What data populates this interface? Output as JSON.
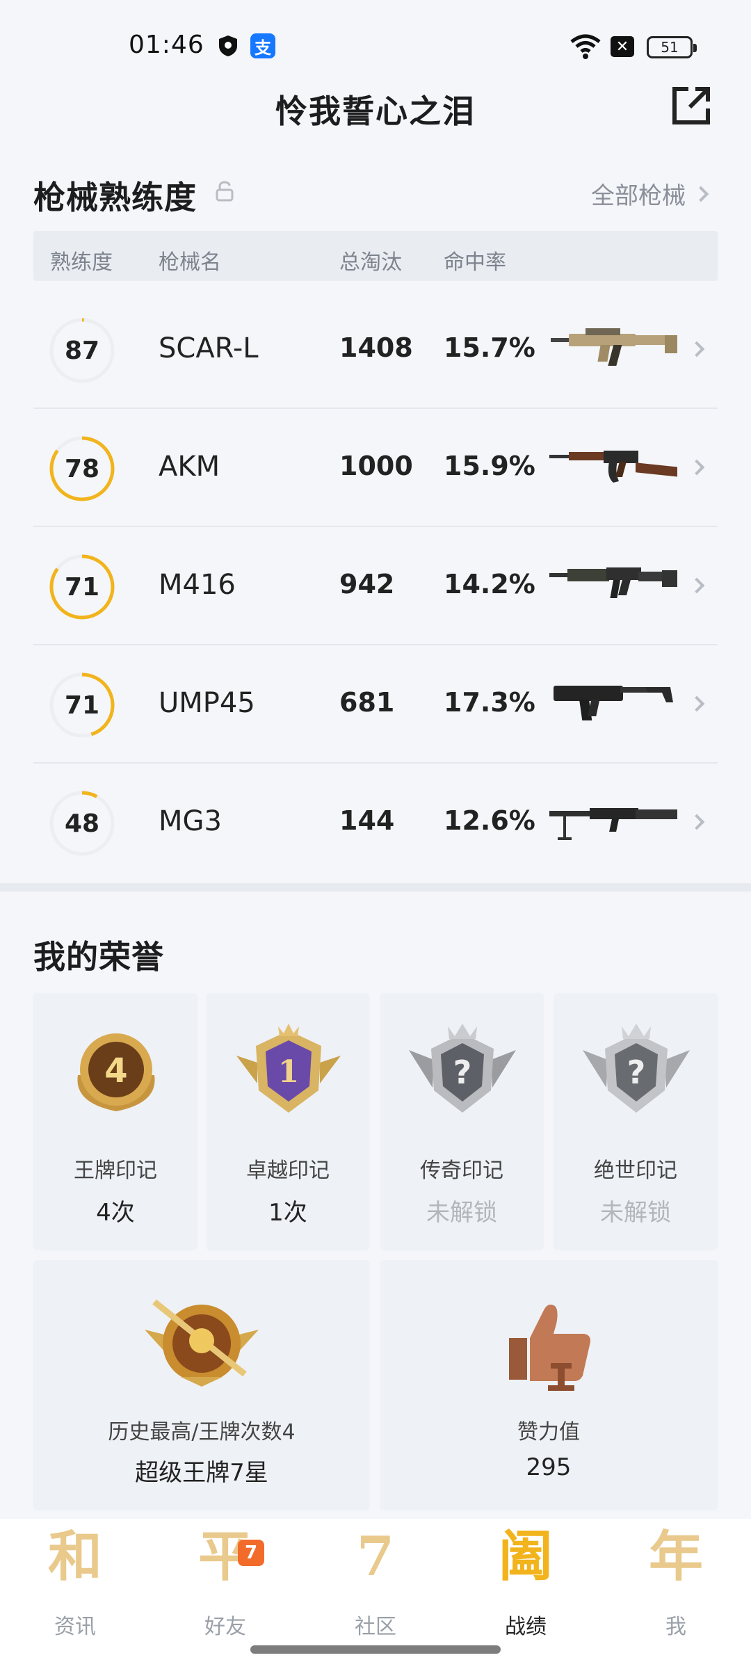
{
  "status_bar": {
    "time": "01:46",
    "alipay_glyph": "支",
    "battery": "51",
    "x_glyph": "✕"
  },
  "header": {
    "title": "怜我誓心之泪",
    "share_icon": "share-icon"
  },
  "weapons": {
    "title": "枪械熟练度",
    "all_link": "全部枪械",
    "columns": {
      "proficiency": "熟练度",
      "name": "枪械名",
      "kills": "总淘汰",
      "hit_rate": "命中率"
    },
    "rows": [
      {
        "level": "87",
        "name": "SCAR-L",
        "kills": "1408",
        "rate": "15.7%",
        "progress": 0.01
      },
      {
        "level": "78",
        "name": "AKM",
        "kills": "1000",
        "rate": "15.9%",
        "progress": 0.85
      },
      {
        "level": "71",
        "name": "M416",
        "kills": "942",
        "rate": "14.2%",
        "progress": 0.85
      },
      {
        "level": "71",
        "name": "UMP45",
        "kills": "681",
        "rate": "17.3%",
        "progress": 0.45
      },
      {
        "level": "48",
        "name": "MG3",
        "kills": "144",
        "rate": "12.6%",
        "progress": 0.08
      }
    ]
  },
  "honors": {
    "title": "我的荣誉",
    "marks": [
      {
        "label": "王牌印记",
        "value": "4次",
        "locked": false,
        "badge_num": "4"
      },
      {
        "label": "卓越印记",
        "value": "1次",
        "locked": false,
        "badge_num": "1"
      },
      {
        "label": "传奇印记",
        "value": "未解锁",
        "locked": true,
        "badge_num": "?"
      },
      {
        "label": "绝世印记",
        "value": "未解锁",
        "locked": true,
        "badge_num": "?"
      }
    ],
    "highest": {
      "label": "历史最高/王牌次数4",
      "value": "超级王牌7星"
    },
    "effort": {
      "label": "赞力值",
      "value": "295"
    }
  },
  "nav": {
    "items": [
      {
        "glyph": "和",
        "label": "资讯"
      },
      {
        "glyph": "平",
        "label": "好友",
        "badge": "7"
      },
      {
        "glyph": "7",
        "label": "社区"
      },
      {
        "glyph": "阖",
        "label": "战绩"
      },
      {
        "glyph": "年",
        "label": "我"
      }
    ]
  },
  "colors": {
    "ring_active": "#f2b41c",
    "ring_track": "#eceef1",
    "accent": "#f2b41c"
  }
}
